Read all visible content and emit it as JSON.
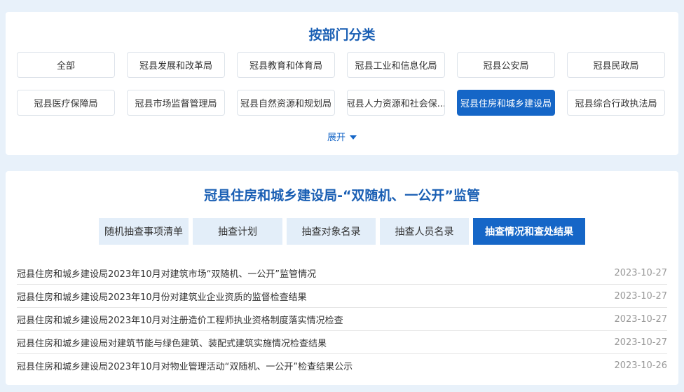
{
  "dept_section": {
    "title": "按部门分类",
    "departments": [
      "全部",
      "冠县发展和改革局",
      "冠县教育和体育局",
      "冠县工业和信息化局",
      "冠县公安局",
      "冠县民政局",
      "冠县医疗保障局",
      "冠县市场监督管理局",
      "冠县自然资源和规划局",
      "冠县人力资源和社会保...",
      "冠县住房和城乡建设局",
      "冠县综合行政执法局"
    ],
    "active_department": "冠县住房和城乡建设局",
    "expand_label": "展开"
  },
  "supervision_section": {
    "title": "冠县住房和城乡建设局-“双随机、一公开”监管",
    "tabs": [
      "随机抽查事项清单",
      "抽查计划",
      "抽查对象名录",
      "抽查人员名录",
      "抽查情况和查处结果"
    ],
    "active_tab": "抽查情况和查处结果",
    "items": [
      {
        "title": "冠县住房和城乡建设局2023年10月对建筑市场“双随机、一公开”监管情况",
        "date": "2023-10-27"
      },
      {
        "title": "冠县住房和城乡建设局2023年10月份对建筑业企业资质的监督检查结果",
        "date": "2023-10-27"
      },
      {
        "title": "冠县住房和城乡建设局2023年10月对注册造价工程师执业资格制度落实情况检查",
        "date": "2023-10-27"
      },
      {
        "title": "冠县住房和城乡建设局对建筑节能与绿色建筑、装配式建筑实施情况检查结果",
        "date": "2023-10-27"
      },
      {
        "title": "冠县住房和城乡建设局2023年10月对物业管理活动“双随机、一公开”检查结果公示",
        "date": "2023-10-26"
      }
    ]
  },
  "colors": {
    "accent": "#1566c7",
    "title": "#1a5fb4",
    "page_background": "#e8f1fa",
    "tab_background": "#e3eef9"
  },
  "icons": {
    "expand": "caret-down-icon"
  }
}
